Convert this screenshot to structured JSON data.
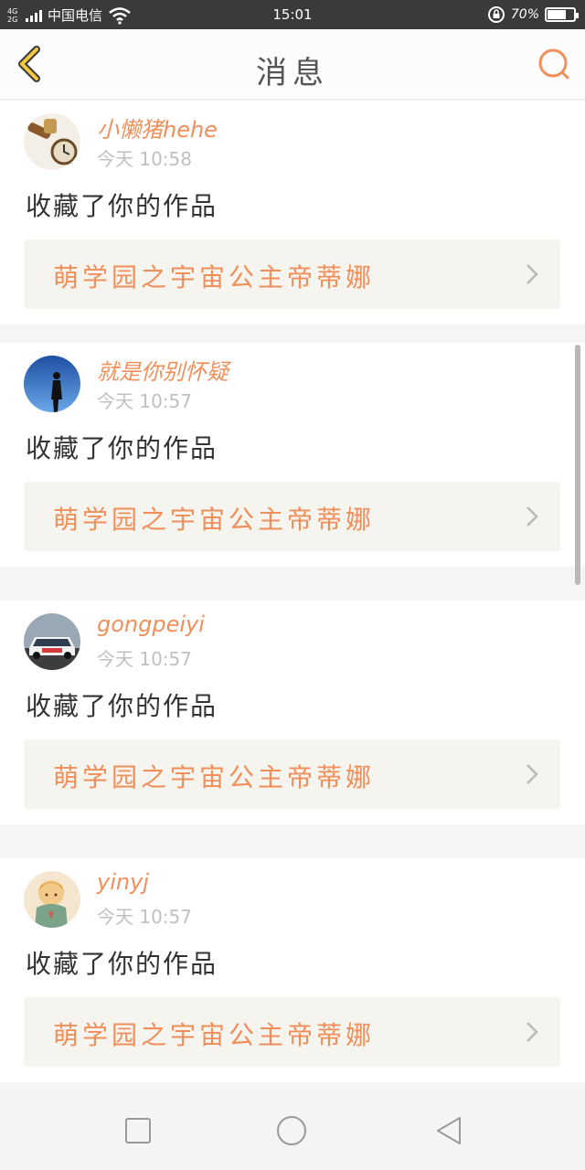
{
  "status_bar": {
    "network_top": "4G",
    "network_bottom": "2G",
    "carrier": "中国电信",
    "time": "15:01",
    "battery": "70%",
    "battery_level": 0.7
  },
  "header": {
    "title": "消息"
  },
  "messages": [
    {
      "username": "小懒猪hehe",
      "time": "今天 10:58",
      "action": "收藏了你的作品",
      "work_title": "萌学园之宇宙公主帝蒂娜"
    },
    {
      "username": "就是你别怀疑",
      "time": "今天 10:57",
      "action": "收藏了你的作品",
      "work_title": "萌学园之宇宙公主帝蒂娜"
    },
    {
      "username": "gongpeiyi",
      "time": "今天 10:57",
      "action": "收藏了你的作品",
      "work_title": "萌学园之宇宙公主帝蒂娜"
    },
    {
      "username": "yinyj",
      "time": "今天 10:57",
      "action": "收藏了你的作品",
      "work_title": "萌学园之宇宙公主帝蒂娜"
    }
  ],
  "colors": {
    "accent": "#f08f5a",
    "back_arrow": "#f5c842",
    "status_bar": "#3a3a3a"
  },
  "icons": {
    "back": "chevron-left-icon",
    "search": "search-icon",
    "row_arrow": "chevron-right-icon",
    "nav_recents": "square-icon",
    "nav_home": "circle-icon",
    "nav_back": "triangle-back-icon"
  }
}
